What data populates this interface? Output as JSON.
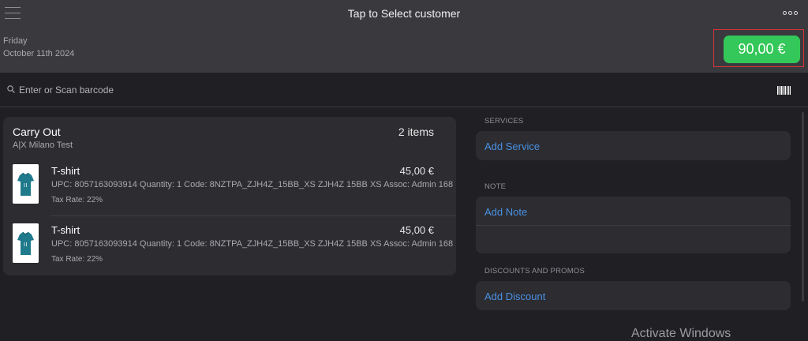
{
  "header": {
    "title": "Tap to Select customer",
    "day": "Friday",
    "date": "October 11th 2024",
    "total": "90,00 €",
    "icons": {
      "menu": "hamburger-menu-icon",
      "more": "more-options-icon"
    }
  },
  "search": {
    "placeholder": "Enter or Scan barcode",
    "value": "",
    "icons": {
      "search": "search-icon",
      "barcode": "barcode-icon"
    }
  },
  "cart": {
    "type": "Carry Out",
    "store": "A|X Milano Test",
    "count": "2 items",
    "items": [
      {
        "name": "T-shirt",
        "price": "45,00 €",
        "details": "UPC: 8057163093914 Quantity: 1 Code: 8NZTPA_ZJH4Z_15BB_XS ZJH4Z 15BB XS Assoc: Admin 168",
        "tax": "Tax Rate: 22%"
      },
      {
        "name": "T-shirt",
        "price": "45,00 €",
        "details": "UPC: 8057163093914 Quantity: 1 Code: 8NZTPA_ZJH4Z_15BB_XS ZJH4Z 15BB XS Assoc: Admin 168",
        "tax": "Tax Rate: 22%"
      }
    ]
  },
  "sections": {
    "services": {
      "label": "SERVICES",
      "action": "Add Service"
    },
    "note": {
      "label": "NOTE",
      "action": "Add Note"
    },
    "discounts": {
      "label": "DISCOUNTS AND PROMOS",
      "action": "Add Discount"
    }
  },
  "watermark": "Activate Windows",
  "colors": {
    "accent": "#4a90e2",
    "total_button": "#34c759",
    "highlight_frame": "#d8343a",
    "background": "#1f1f24",
    "panel": "#2c2c31"
  }
}
